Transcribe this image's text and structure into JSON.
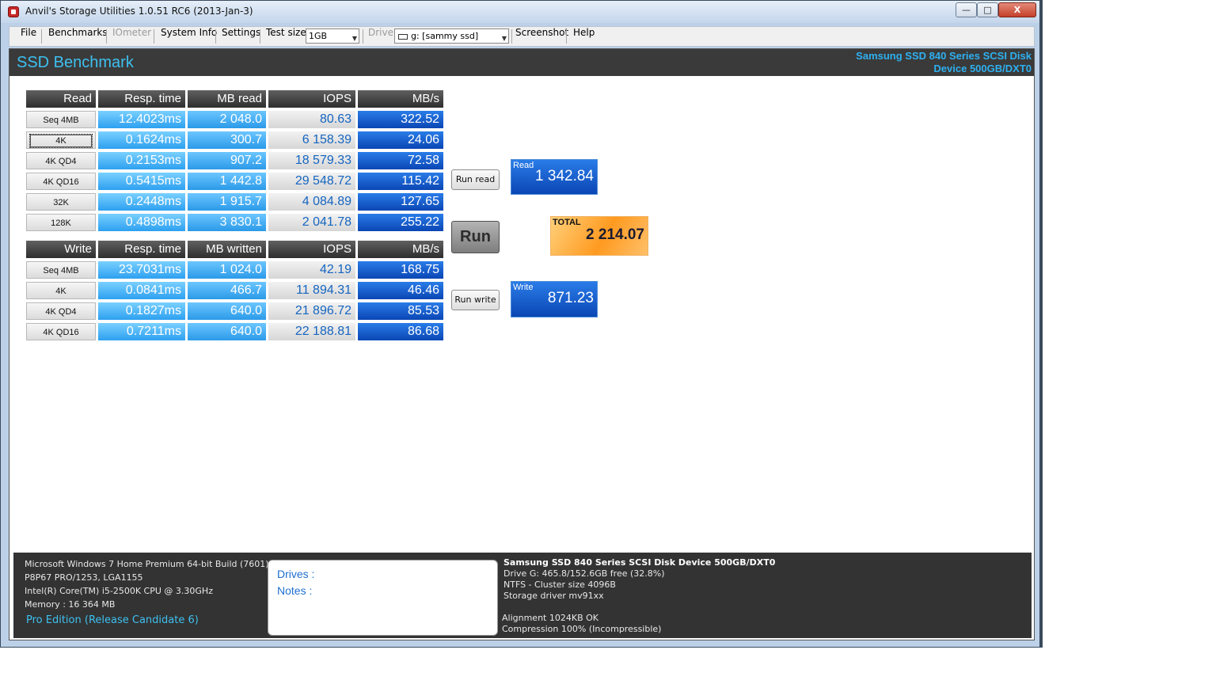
{
  "window": {
    "title": "Anvil's Storage Utilities 1.0.51 RC6 (2013-Jan-3)",
    "min_label": "—",
    "max_label": "□",
    "close_label": "X"
  },
  "menu": {
    "file": "File",
    "benchmarks": "Benchmarks",
    "iometer": "IOmeter",
    "system_info": "System Info",
    "settings": "Settings",
    "test_size_label": "Test size",
    "test_size_value": "1GB",
    "drive_label": "Drive",
    "drive_value": "g: [sammy ssd]",
    "screenshot": "Screenshot",
    "help": "Help"
  },
  "header": {
    "title": "SSD Benchmark",
    "drive_line1": "Samsung SSD 840 Series SCSI Disk",
    "drive_line2": "Device 500GB/DXT0"
  },
  "read_table": {
    "headers": [
      "Read",
      "Resp. time",
      "MB read",
      "IOPS",
      "MB/s"
    ],
    "rows": [
      {
        "label": "Seq 4MB",
        "resp": "12.4023ms",
        "mb": "2 048.0",
        "iops": "80.63",
        "mbs": "322.52"
      },
      {
        "label": "4K",
        "resp": "0.1624ms",
        "mb": "300.7",
        "iops": "6 158.39",
        "mbs": "24.06"
      },
      {
        "label": "4K QD4",
        "resp": "0.2153ms",
        "mb": "907.2",
        "iops": "18 579.33",
        "mbs": "72.58"
      },
      {
        "label": "4K QD16",
        "resp": "0.5415ms",
        "mb": "1 442.8",
        "iops": "29 548.72",
        "mbs": "115.42"
      },
      {
        "label": "32K",
        "resp": "0.2448ms",
        "mb": "1 915.7",
        "iops": "4 084.89",
        "mbs": "127.65"
      },
      {
        "label": "128K",
        "resp": "0.4898ms",
        "mb": "3 830.1",
        "iops": "2 041.78",
        "mbs": "255.22"
      }
    ]
  },
  "write_table": {
    "headers": [
      "Write",
      "Resp. time",
      "MB written",
      "IOPS",
      "MB/s"
    ],
    "rows": [
      {
        "label": "Seq 4MB",
        "resp": "23.7031ms",
        "mb": "1 024.0",
        "iops": "42.19",
        "mbs": "168.75"
      },
      {
        "label": "4K",
        "resp": "0.0841ms",
        "mb": "466.7",
        "iops": "11 894.31",
        "mbs": "46.46"
      },
      {
        "label": "4K QD4",
        "resp": "0.1827ms",
        "mb": "640.0",
        "iops": "21 896.72",
        "mbs": "85.53"
      },
      {
        "label": "4K QD16",
        "resp": "0.7211ms",
        "mb": "640.0",
        "iops": "22 188.81",
        "mbs": "86.68"
      }
    ]
  },
  "controls": {
    "run_read": "Run read",
    "run": "Run",
    "run_write": "Run write"
  },
  "scores": {
    "read_label": "Read",
    "read_value": "1 342.84",
    "total_label": "TOTAL",
    "total_value": "2 214.07",
    "write_label": "Write",
    "write_value": "871.23"
  },
  "system": {
    "os": "Microsoft Windows 7 Home Premium  64-bit Build (7601)",
    "board": "P8P67 PRO/1253, LGA1155",
    "cpu": "Intel(R) Core(TM) i5-2500K CPU @ 3.30GHz",
    "memory": "Memory : 16 364 MB",
    "edition": "Pro Edition (Release Candidate 6)"
  },
  "notes": {
    "drives_label": "Drives :",
    "notes_label": "Notes :"
  },
  "drive_info": {
    "name": "Samsung SSD 840 Series SCSI Disk Device 500GB/DXT0",
    "space": "Drive G: 465.8/152.6GB free (32.8%)",
    "fs": "NTFS - Cluster size 4096B",
    "driver": "Storage driver  mv91xx",
    "alignment": "Alignment 1024KB OK",
    "compression": "Compression 100% (Incompressible)"
  },
  "colors": {
    "accent": "#3dc0f0",
    "header_bg": "#3a3a3a",
    "mbs_blue": "#0a46b4",
    "total_orange": "#ff9a20"
  }
}
